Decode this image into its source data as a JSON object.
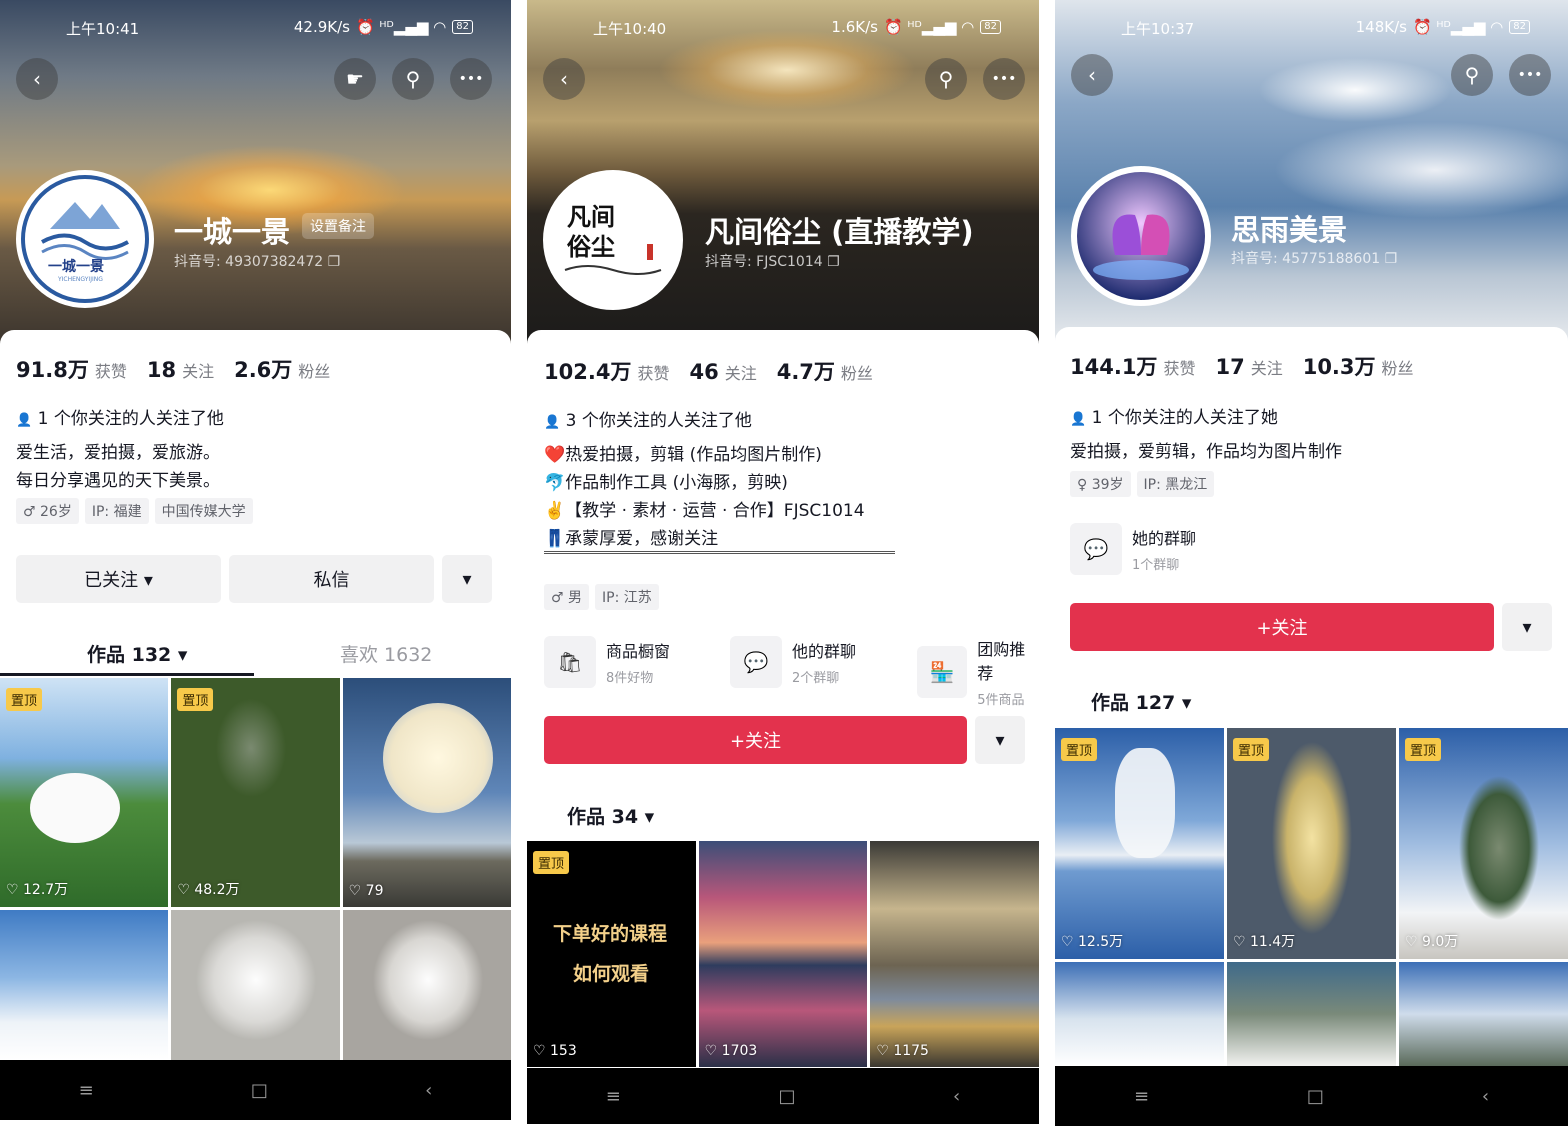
{
  "status_icons": "⏰ ᴴᴰ▂▄▆ ◠",
  "nav": {
    "menu": "≡",
    "home": "□",
    "back": "‹"
  },
  "icons": {
    "back": "‹",
    "share": "☛",
    "search": "⚲",
    "more": "•••",
    "copy": "❐",
    "person": "👤",
    "arrow": "▾",
    "heart": "♡"
  },
  "p1": {
    "status": {
      "time": "上午10:41",
      "speed": "42.9K/s",
      "battery": "82"
    },
    "avatar_text": "一城一景",
    "avatar_sub": "YICHENGYIJING",
    "name": "一城一景",
    "remark": "设置备注",
    "uid": "抖音号: 49307382472",
    "stats": [
      {
        "value": "91.8万",
        "label": "获赞"
      },
      {
        "value": "18",
        "label": "关注"
      },
      {
        "value": "2.6万",
        "label": "粉丝"
      }
    ],
    "mutual": "1 个你关注的人关注了他",
    "bio": [
      "爱生活，爱拍摄，爱旅游。",
      "每日分享遇见的天下美景。"
    ],
    "tags": [
      "♂ 26岁",
      "IP: 福建",
      "中国传媒大学"
    ],
    "buttons": {
      "followed": "已关注 ▾",
      "message": "私信",
      "more": "▾"
    },
    "tabs": {
      "works": "作品 132 ▾",
      "likes": "喜欢 1632"
    },
    "pin": "置顶",
    "tiles": [
      {
        "likes": "♡ 12.7万",
        "pinned": true
      },
      {
        "likes": "♡ 48.2万",
        "pinned": true
      },
      {
        "likes": "♡ 79",
        "pinned": false
      },
      {
        "likes": "",
        "pinned": false
      },
      {
        "likes": "",
        "pinned": false
      },
      {
        "likes": "",
        "pinned": false
      }
    ]
  },
  "p2": {
    "status": {
      "time": "上午10:40",
      "speed": "1.6K/s",
      "battery": "82"
    },
    "avatar_text": "凡间俗尘",
    "name": "凡间俗尘 (直播教学)",
    "uid": "抖音号: FJSC1014",
    "stats": [
      {
        "value": "102.4万",
        "label": "获赞"
      },
      {
        "value": "46",
        "label": "关注"
      },
      {
        "value": "4.7万",
        "label": "粉丝"
      }
    ],
    "mutual": "3 个你关注的人关注了他",
    "bio": [
      "❤️热爱拍摄，剪辑 (作品均图片制作)",
      "🐬作品制作工具 (小海豚，剪映)",
      "✌️【教学 · 素材 · 运营 · 合作】FJSC1014",
      "👖承蒙厚爱，感谢关注"
    ],
    "tags": [
      "♂ 男",
      "IP: 江苏"
    ],
    "features": [
      {
        "title": "商品橱窗",
        "sub": "8件好物",
        "icon": "🛍"
      },
      {
        "title": "他的群聊",
        "sub": "2个群聊",
        "icon": "💬"
      },
      {
        "title": "团购推荐",
        "sub": "5件商品",
        "icon": "🏪"
      }
    ],
    "follow": "+关注",
    "more": "▾",
    "tabs": {
      "works": "作品 34 ▾"
    },
    "pin": "置顶",
    "tile_text": [
      "下单好的课程",
      "如何观看"
    ],
    "tiles": [
      {
        "likes": "♡ 153",
        "pinned": true
      },
      {
        "likes": "♡ 1703",
        "pinned": false
      },
      {
        "likes": "♡ 1175",
        "pinned": false
      }
    ]
  },
  "p3": {
    "status": {
      "time": "上午10:37",
      "speed": "148K/s",
      "battery": "82"
    },
    "name": "思雨美景",
    "uid": "抖音号: 45775188601",
    "stats": [
      {
        "value": "144.1万",
        "label": "获赞"
      },
      {
        "value": "17",
        "label": "关注"
      },
      {
        "value": "10.3万",
        "label": "粉丝"
      }
    ],
    "mutual": "1 个你关注的人关注了她",
    "bio": [
      "爱拍摄，爱剪辑，作品均为图片制作"
    ],
    "tags": [
      "♀ 39岁",
      "IP: 黑龙江"
    ],
    "group": {
      "title": "她的群聊",
      "sub": "1个群聊",
      "icon": "💬"
    },
    "follow": "+关注",
    "more": "▾",
    "tabs": {
      "works": "作品 127 ▾"
    },
    "pin": "置顶",
    "tiles": [
      {
        "likes": "♡ 12.5万",
        "pinned": true
      },
      {
        "likes": "♡ 11.4万",
        "pinned": true
      },
      {
        "likes": "♡ 9.0万",
        "pinned": true
      },
      {
        "likes": "",
        "pinned": false
      },
      {
        "likes": "",
        "pinned": false
      },
      {
        "likes": "",
        "pinned": false
      }
    ]
  }
}
